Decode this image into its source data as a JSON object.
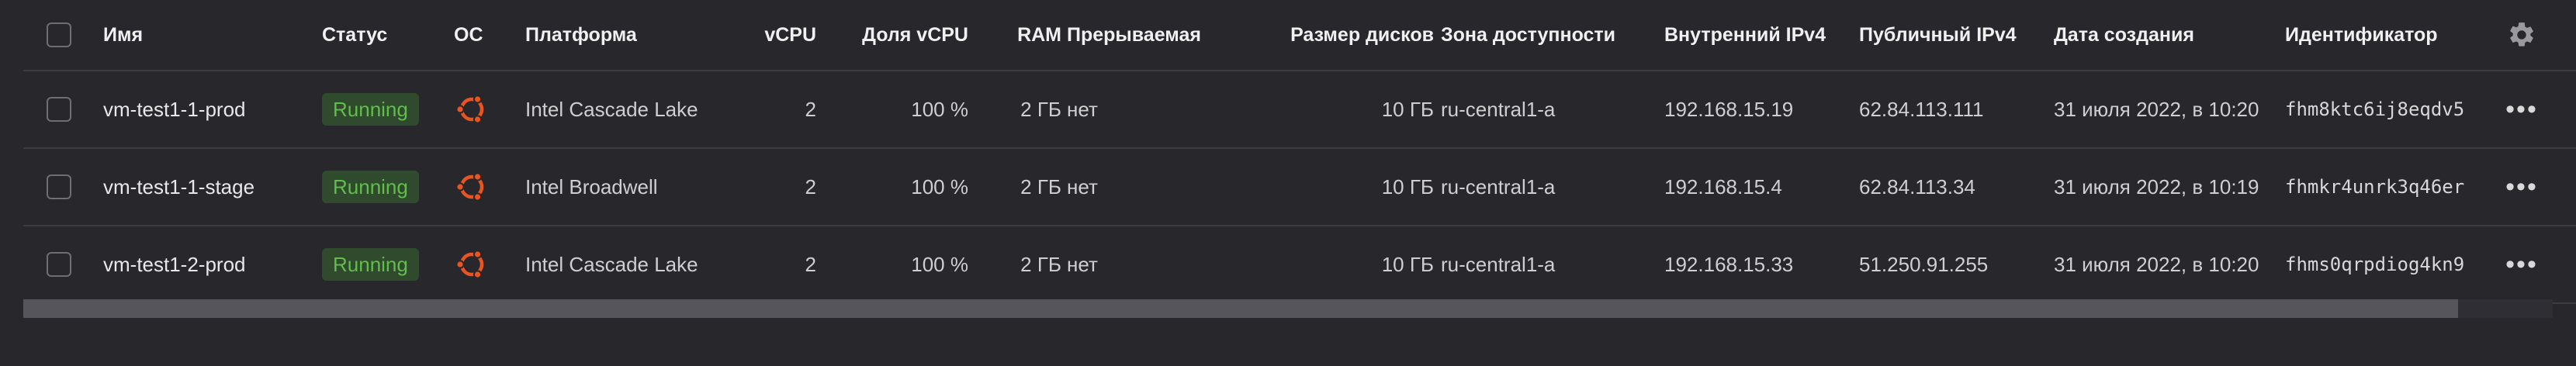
{
  "columns": {
    "name": "Имя",
    "status": "Статус",
    "os": "ОС",
    "platform": "Платформа",
    "vcpu": "vCPU",
    "vcpu_share": "Доля vCPU",
    "ram": "RAM",
    "preemptible": "Прерываемая",
    "disk_size": "Размер дисков",
    "zone": "Зона доступности",
    "ip_internal": "Внутренний IPv4",
    "ip_public": "Публичный IPv4",
    "created": "Дата создания",
    "id": "Идентификатор"
  },
  "header_icons": {
    "settings": "gear-icon"
  },
  "rows": [
    {
      "name": "vm-test1-1-prod",
      "status": "Running",
      "os_icon": "ubuntu-icon",
      "platform": "Intel Cascade Lake",
      "vcpu": "2",
      "vcpu_share": "100 %",
      "ram": "2 ГБ",
      "preemptible": "нет",
      "disk_size": "10 ГБ",
      "zone": "ru-central1-a",
      "ip_internal": "192.168.15.19",
      "ip_public": "62.84.113.111",
      "created": "31 июля 2022, в 10:20",
      "id": "fhm8ktc6ij8eqdv5"
    },
    {
      "name": "vm-test1-1-stage",
      "status": "Running",
      "os_icon": "ubuntu-icon",
      "platform": "Intel Broadwell",
      "vcpu": "2",
      "vcpu_share": "100 %",
      "ram": "2 ГБ",
      "preemptible": "нет",
      "disk_size": "10 ГБ",
      "zone": "ru-central1-a",
      "ip_internal": "192.168.15.4",
      "ip_public": "62.84.113.34",
      "created": "31 июля 2022, в 10:19",
      "id": "fhmkr4unrk3q46er"
    },
    {
      "name": "vm-test1-2-prod",
      "status": "Running",
      "os_icon": "ubuntu-icon",
      "platform": "Intel Cascade Lake",
      "vcpu": "2",
      "vcpu_share": "100 %",
      "ram": "2 ГБ",
      "preemptible": "нет",
      "disk_size": "10 ГБ",
      "zone": "ru-central1-a",
      "ip_internal": "192.168.15.33",
      "ip_public": "51.250.91.255",
      "created": "31 июля 2022, в 10:20",
      "id": "fhms0qrpdiog4kn9"
    }
  ],
  "colors": {
    "background": "#28272c",
    "status_running_text": "#5fbf4a",
    "status_running_bg": "#2f4a2c",
    "ubuntu_orange": "#e95420"
  }
}
